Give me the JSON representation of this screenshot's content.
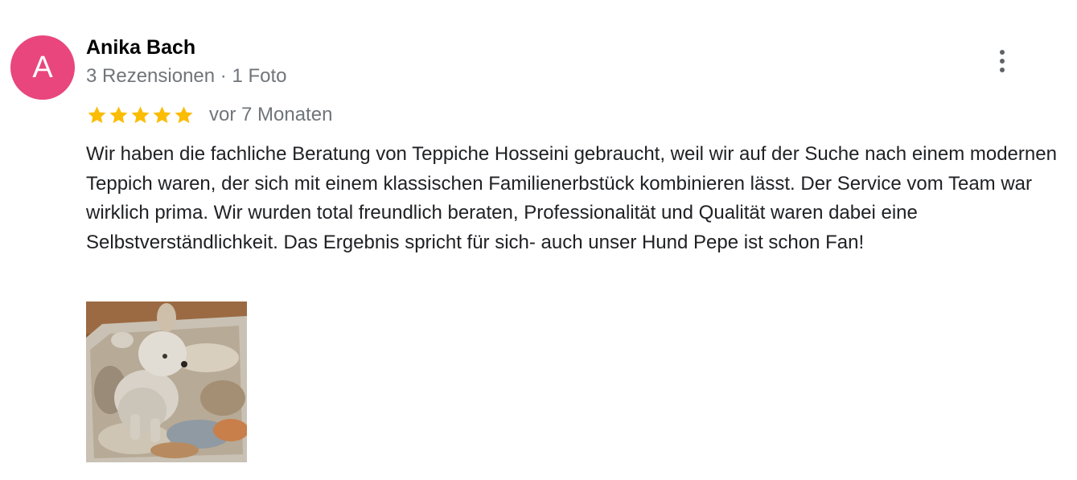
{
  "author": {
    "initial": "A",
    "name": "Anika Bach",
    "meta": "3 Rezensionen · 1 Foto",
    "avatar_color": "#e8467d"
  },
  "rating": {
    "stars": 5,
    "max_stars": 5,
    "star_color": "#fbbc04",
    "time_ago": "vor 7 Monaten"
  },
  "review": {
    "text": "Wir haben die fachliche Beratung von Teppiche Hosseini gebraucht, weil wir auf der Suche nach einem modernen Teppich waren, der sich mit einem klassischen Familienerbstück kombinieren lässt. Der Service vom Team war wirklich prima. Wir wurden total freundlich beraten, Professionalität und Qualität waren dabei eine Selbstverständlichkeit. Das Ergebnis spricht für sich- auch unser Hund Pepe ist schon Fan!"
  },
  "menu": {
    "icon": "more-vert-icon"
  },
  "photos": [
    {
      "icon": "dog-on-rug-photo"
    }
  ]
}
